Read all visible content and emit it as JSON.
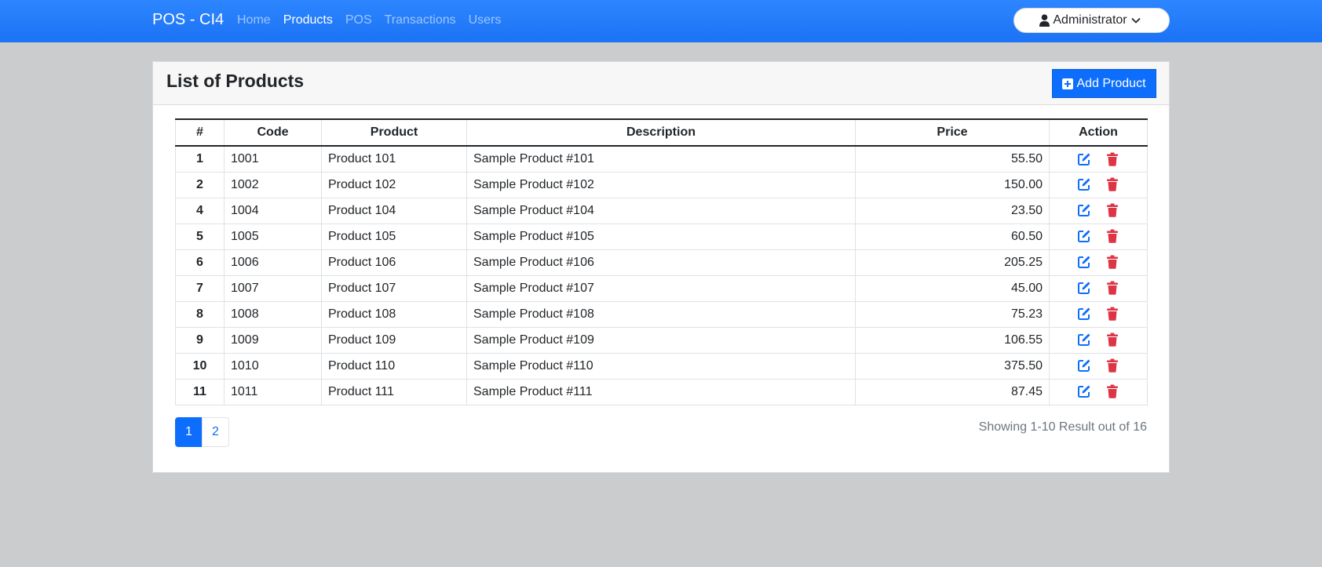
{
  "navbar": {
    "brand": "POS - CI4",
    "links": [
      "Home",
      "Products",
      "POS",
      "Transactions",
      "Users"
    ],
    "active_link": "Products",
    "user_label": "Administrator"
  },
  "card": {
    "title": "List of Products",
    "add_button": "Add Product"
  },
  "table": {
    "headers": [
      "#",
      "Code",
      "Product",
      "Description",
      "Price",
      "Action"
    ],
    "rows": [
      {
        "num": "1",
        "code": "1001",
        "product": "Product 101",
        "description": "Sample Product #101",
        "price": "55.50"
      },
      {
        "num": "2",
        "code": "1002",
        "product": "Product 102",
        "description": "Sample Product #102",
        "price": "150.00"
      },
      {
        "num": "4",
        "code": "1004",
        "product": "Product 104",
        "description": "Sample Product #104",
        "price": "23.50"
      },
      {
        "num": "5",
        "code": "1005",
        "product": "Product 105",
        "description": "Sample Product #105",
        "price": "60.50"
      },
      {
        "num": "6",
        "code": "1006",
        "product": "Product 106",
        "description": "Sample Product #106",
        "price": "205.25"
      },
      {
        "num": "7",
        "code": "1007",
        "product": "Product 107",
        "description": "Sample Product #107",
        "price": "45.00"
      },
      {
        "num": "8",
        "code": "1008",
        "product": "Product 108",
        "description": "Sample Product #108",
        "price": "75.23"
      },
      {
        "num": "9",
        "code": "1009",
        "product": "Product 109",
        "description": "Sample Product #109",
        "price": "106.55"
      },
      {
        "num": "10",
        "code": "1010",
        "product": "Product 110",
        "description": "Sample Product #110",
        "price": "375.50"
      },
      {
        "num": "11",
        "code": "1011",
        "product": "Product 111",
        "description": "Sample Product #111",
        "price": "87.45"
      }
    ]
  },
  "pagination": {
    "pages": [
      "1",
      "2"
    ],
    "active_page": "1",
    "showing_text": "Showing 1-10 Result out of 16"
  },
  "colors": {
    "primary": "#0d6efd",
    "danger": "#dc3545",
    "navbar": "#1b72f5"
  },
  "icons": {
    "user": "user-icon",
    "chevron": "chevron-down-icon",
    "add": "plus-square-icon",
    "edit": "edit-icon",
    "delete": "trash-icon"
  }
}
